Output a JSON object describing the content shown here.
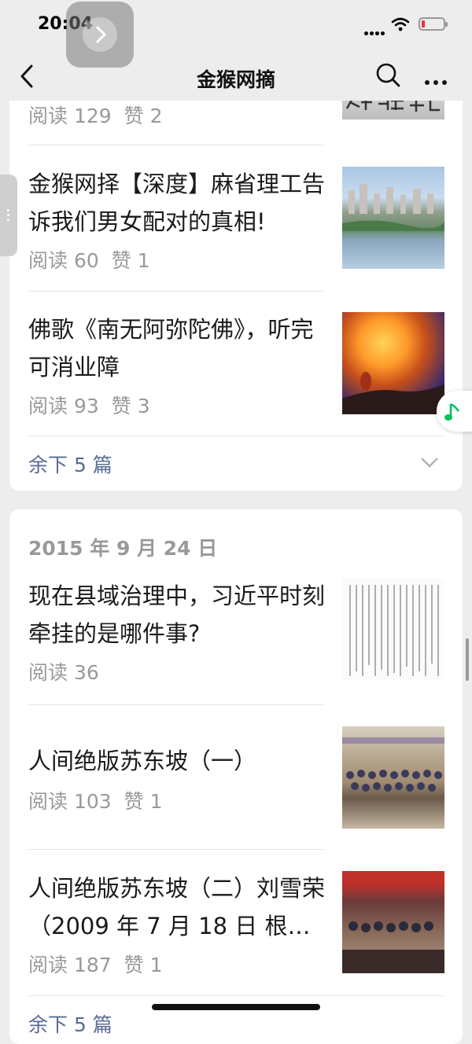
{
  "status_bar": {
    "time": "20:04"
  },
  "nav": {
    "title": "金猴网摘"
  },
  "card1": {
    "articles": [
      {
        "meta": [
          "阅读 129",
          "赞 2"
        ]
      },
      {
        "title": "金猴网择【深度】麻省理工告诉我们男女配对的真相!",
        "meta": [
          "阅读 60",
          "赞 1"
        ]
      },
      {
        "title": "佛歌《南无阿弥陀佛》，听完可消业障",
        "meta": [
          "阅读 93",
          "赞 3"
        ]
      }
    ],
    "more_label": "余下 5 篇"
  },
  "card2": {
    "date": "2015 年 9 月 24 日",
    "articles": [
      {
        "title": "现在县域治理中，习近平时刻牵挂的是哪件事?",
        "meta": [
          "阅读 36"
        ]
      },
      {
        "title": "人间绝版苏东坡（一）",
        "meta": [
          "阅读 103",
          "赞 1"
        ]
      },
      {
        "title": "人间绝版苏东坡（二）刘雪荣（2009 年 7 月 18 日 根…",
        "meta": [
          "阅读 187",
          "赞 1"
        ]
      }
    ],
    "more_label": "余下 5 篇"
  },
  "icons": [
    "back-arrow-icon",
    "search-icon",
    "more-icon",
    "chevron-down-icon",
    "music-note-icon",
    "wifi-icon",
    "battery-icon"
  ],
  "colors": {
    "link": "#576b95",
    "meta": "#999999",
    "background": "#ededed",
    "music": "#07c160"
  }
}
